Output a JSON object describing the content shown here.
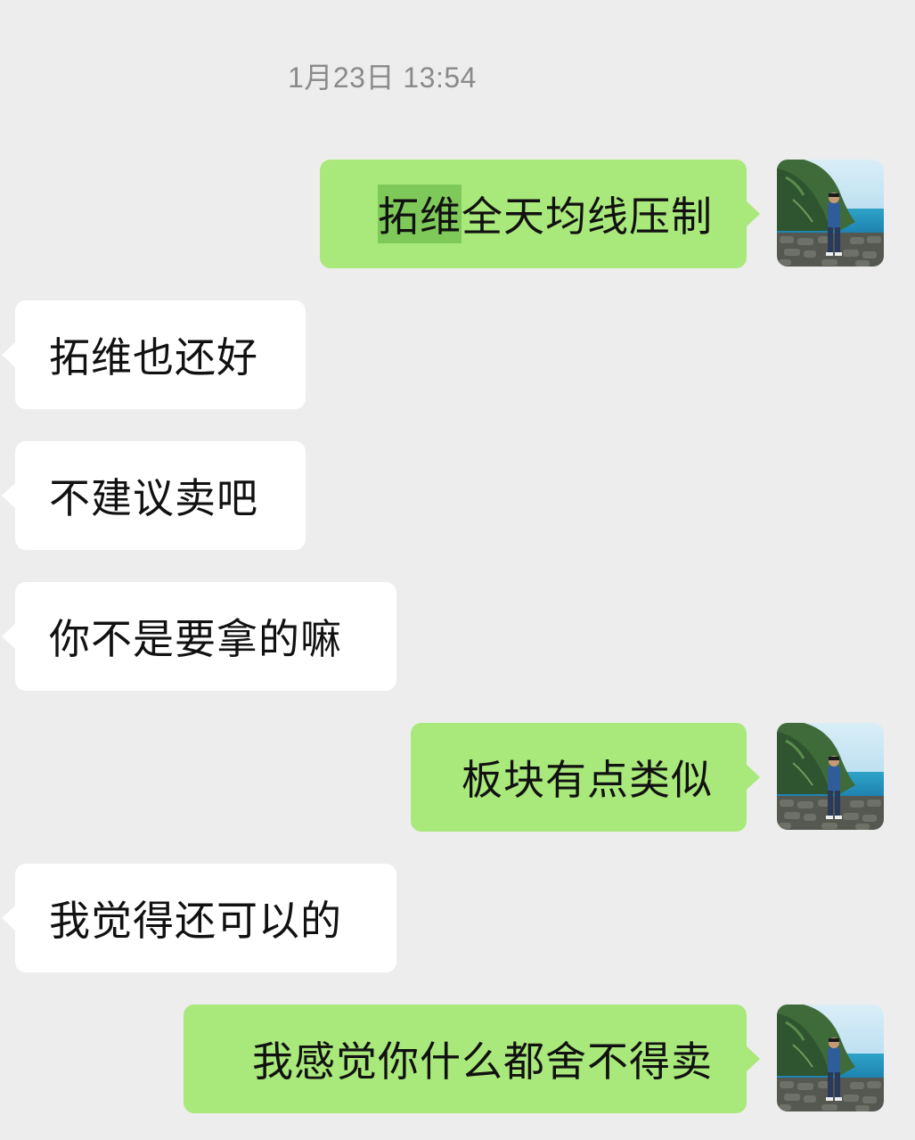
{
  "chat": {
    "timestamp": "1月23日 13:54",
    "messages": [
      {
        "side": "sent",
        "highlight": "拓维",
        "text": "全天均线压制"
      },
      {
        "side": "received",
        "text": "拓维也还好"
      },
      {
        "side": "received",
        "text": "不建议卖吧"
      },
      {
        "side": "received",
        "text": "你不是要拿的嘛"
      },
      {
        "side": "sent",
        "text": "板块有点类似"
      },
      {
        "side": "received",
        "text": "我觉得还可以的"
      },
      {
        "side": "sent",
        "text": "我感觉你什么都舍不得卖"
      }
    ]
  },
  "colors": {
    "background": "#ededed",
    "sent_bubble": "#a9e87a",
    "received_bubble": "#ffffff",
    "highlight": "#7ec95a",
    "timestamp_text": "#8a8a8a"
  },
  "icons": {
    "avatar": "avatar-photo-icon"
  }
}
